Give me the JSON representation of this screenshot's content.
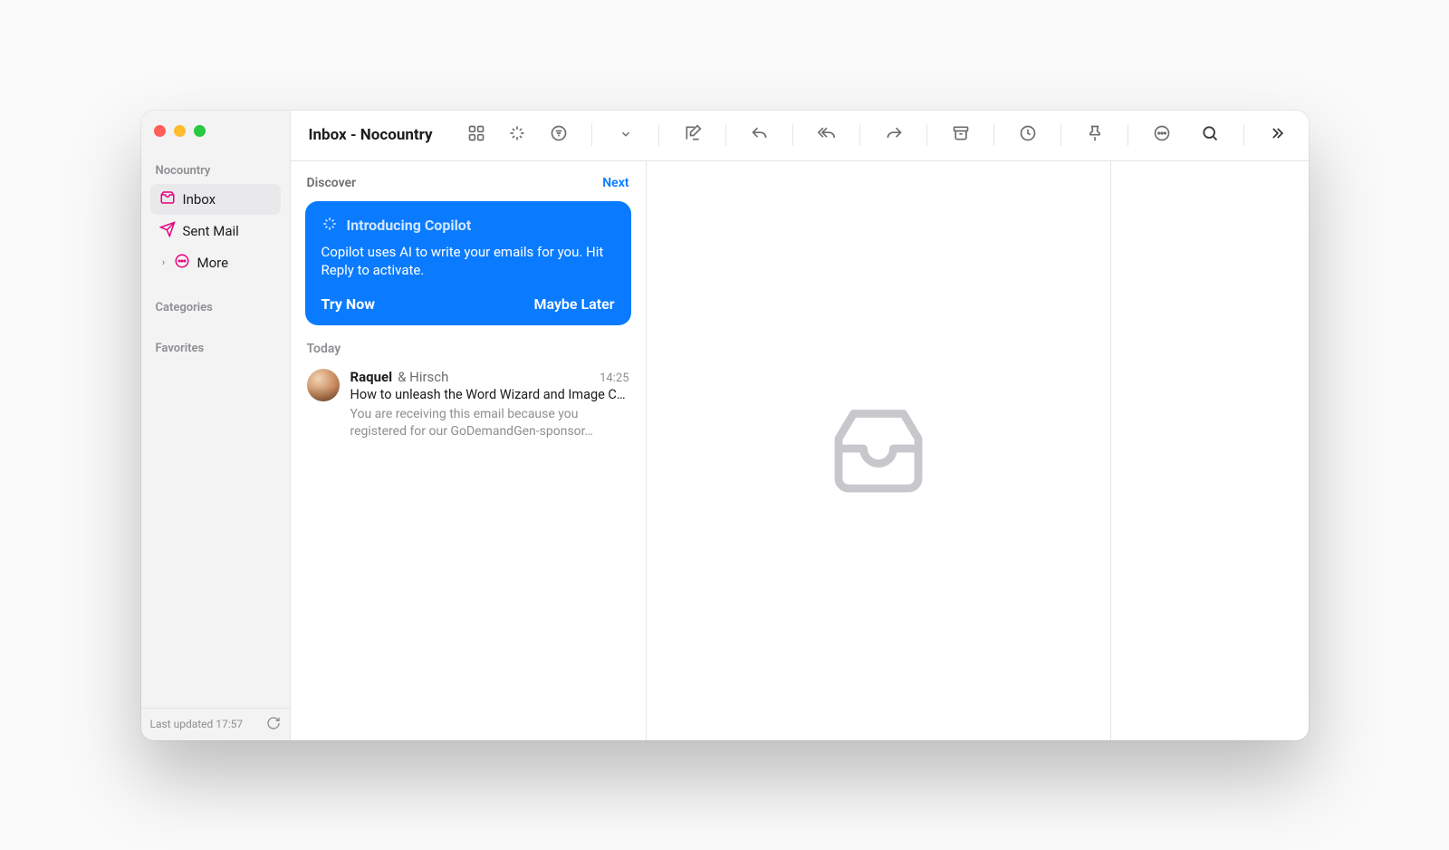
{
  "window_title": "Inbox - Nocountry",
  "sidebar": {
    "account": "Nocountry",
    "items": [
      {
        "label": "Inbox"
      },
      {
        "label": "Sent Mail"
      },
      {
        "label": "More"
      }
    ],
    "sections": {
      "categories": "Categories",
      "favorites": "Favorites"
    },
    "footer": "Last updated 17:57"
  },
  "discover": {
    "label": "Discover",
    "next": "Next"
  },
  "promo": {
    "title": "Introducing Copilot",
    "body": "Copilot uses AI to write your emails for you. Hit Reply to activate.",
    "try": "Try Now",
    "later": "Maybe Later"
  },
  "list": {
    "section_today": "Today",
    "messages": [
      {
        "from_primary": "Raquel",
        "from_secondary": "& Hirsch",
        "time": "14:25",
        "subject": "How to unleash the Word Wizard and Image Co…",
        "preview": "You are receiving this email because you registered for our GoDemandGen-sponsor…"
      }
    ]
  }
}
